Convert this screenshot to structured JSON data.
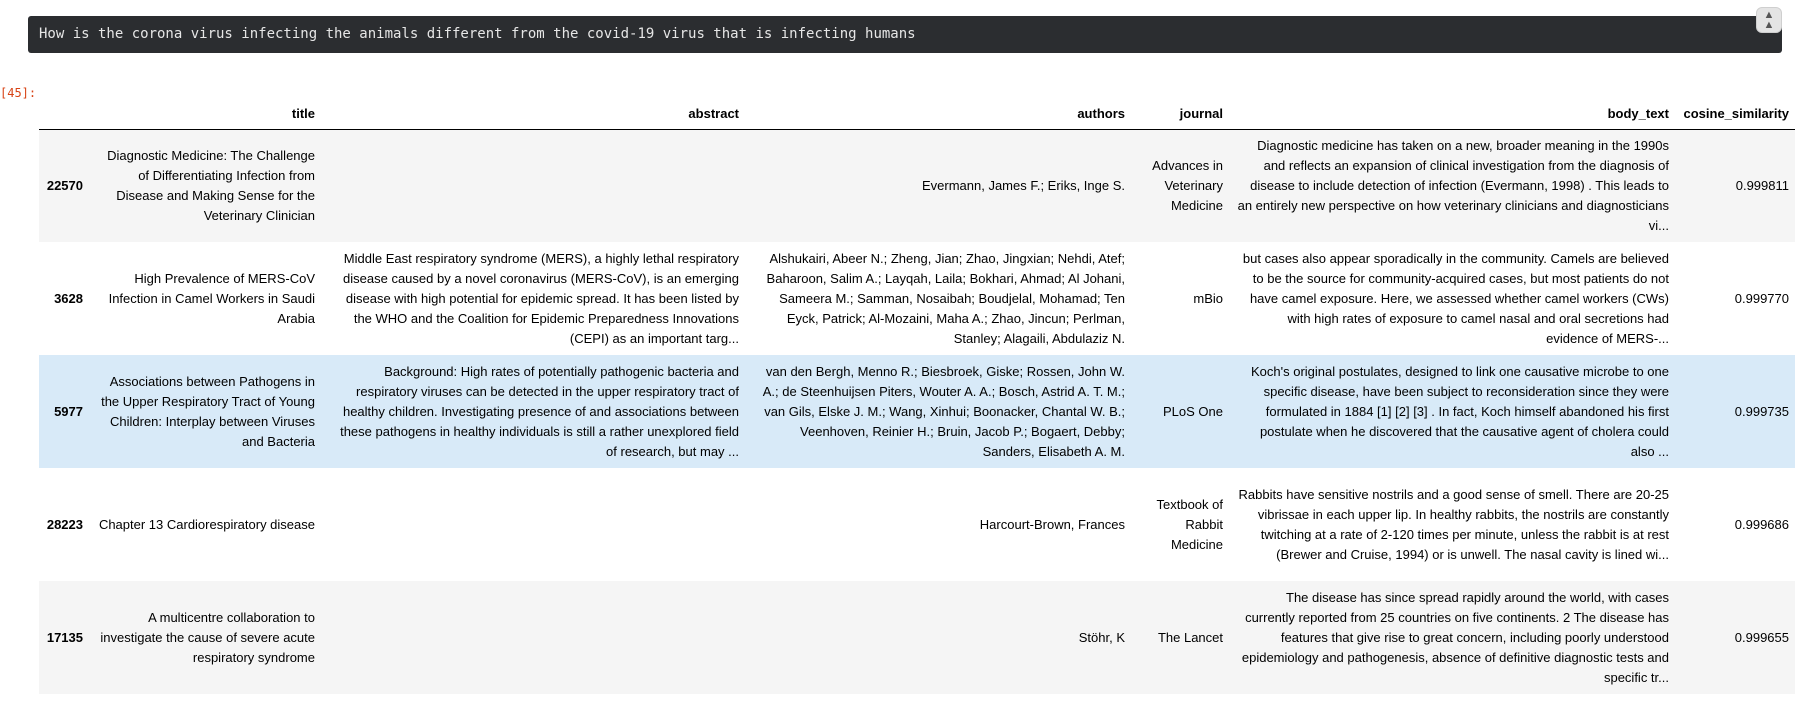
{
  "query": {
    "text": "How is the corona virus infecting the animals different from the covid-19 virus that is infecting humans",
    "collapse_icon": "collapse-up-icon"
  },
  "cell": {
    "prompt": "[45]:"
  },
  "table": {
    "columns": [
      "",
      "title",
      "abstract",
      "authors",
      "journal",
      "body_text",
      "cosine_similarity"
    ],
    "rows": [
      {
        "index": "22570",
        "title": "Diagnostic Medicine: The Challenge of Differentiating Infection from Disease and Making Sense for the Veterinary Clinician",
        "abstract": "",
        "authors": "Evermann, James F.; Eriks, Inge S.",
        "journal": "Advances in Veterinary Medicine",
        "body_text": "Diagnostic medicine has taken on a new, broader meaning in the 1990s and reflects an expansion of clinical investigation from the diagnosis of disease to include detection of infection (Evermann, 1998) . This leads to an entirely new perspective on how veterinary clinicians and diagnosticians vi...",
        "cosine_similarity": "0.999811"
      },
      {
        "index": "3628",
        "title": "High Prevalence of MERS-CoV Infection in Camel Workers in Saudi Arabia",
        "abstract": "Middle East respiratory syndrome (MERS), a highly lethal respiratory disease caused by a novel coronavirus (MERS-CoV), is an emerging disease with high potential for epidemic spread. It has been listed by the WHO and the Coalition for Epidemic Preparedness Innovations (CEPI) as an important targ...",
        "authors": "Alshukairi, Abeer N.; Zheng, Jian; Zhao, Jingxian; Nehdi, Atef; Baharoon, Salim A.; Layqah, Laila; Bokhari, Ahmad; Al Johani, Sameera M.; Samman, Nosaibah; Boudjelal, Mohamad; Ten Eyck, Patrick; Al-Mozaini, Maha A.; Zhao, Jincun; Perlman, Stanley; Alagaili, Abdulaziz N.",
        "journal": "mBio",
        "body_text": "but cases also appear sporadically in the community. Camels are believed to be the source for community-acquired cases, but most patients do not have camel exposure. Here, we assessed whether camel workers (CWs) with high rates of exposure to camel nasal and oral secretions had evidence of MERS-...",
        "cosine_similarity": "0.999770"
      },
      {
        "index": "5977",
        "title": "Associations between Pathogens in the Upper Respiratory Tract of Young Children: Interplay between Viruses and Bacteria",
        "abstract": "Background: High rates of potentially pathogenic bacteria and respiratory viruses can be detected in the upper respiratory tract of healthy children. Investigating presence of and associations between these pathogens in healthy individuals is still a rather unexplored field of research, but may ...",
        "authors": "van den Bergh, Menno R.; Biesbroek, Giske; Rossen, John W. A.; de Steenhuijsen Piters, Wouter A. A.; Bosch, Astrid A. T. M.; van Gils, Elske J. M.; Wang, Xinhui; Boonacker, Chantal W. B.; Veenhoven, Reinier H.; Bruin, Jacob P.; Bogaert, Debby; Sanders, Elisabeth A. M.",
        "journal": "PLoS One",
        "body_text": "Koch's original postulates, designed to link one causative microbe to one specific disease, have been subject to reconsideration since they were formulated in 1884 [1] [2] [3] . In fact, Koch himself abandoned his first postulate when he discovered that the causative agent of cholera could also ...",
        "cosine_similarity": "0.999735"
      },
      {
        "index": "28223",
        "title": "Chapter 13 Cardiorespiratory disease",
        "abstract": "",
        "authors": "Harcourt-Brown, Frances",
        "journal": "Textbook of Rabbit Medicine",
        "body_text": "Rabbits have sensitive nostrils and a good sense of smell. There are 20-25 vibrissae in each upper lip. In healthy rabbits, the nostrils are constantly twitching at a rate of 2-120 times per minute, unless the rabbit is at rest (Brewer and Cruise, 1994) or is unwell. The nasal cavity is lined wi...",
        "cosine_similarity": "0.999686"
      },
      {
        "index": "17135",
        "title": "A multicentre collaboration to investigate the cause of severe acute respiratory syndrome",
        "abstract": "",
        "authors": "Stöhr, K",
        "journal": "The Lancet",
        "body_text": "The disease has since spread rapidly around the world, with cases currently reported from 25 countries on five continents. 2 The disease has features that give rise to great concern, including poorly understood epidemiology and pathogenesis, absence of definitive diagnostic tests and specific tr...",
        "cosine_similarity": "0.999655"
      }
    ]
  }
}
